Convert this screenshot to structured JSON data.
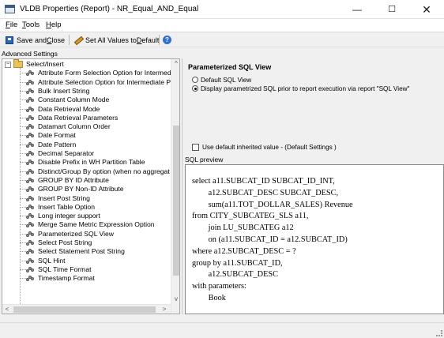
{
  "window": {
    "title": "VLDB Properties (Report) - NR_Equal_AND_Equal",
    "minimize_glyph": "—",
    "maximize_glyph": "☐",
    "close_glyph": "✕"
  },
  "menu": {
    "file": {
      "mnemonic": "F",
      "rest": "ile"
    },
    "tools": {
      "mnemonic": "T",
      "rest": "ools"
    },
    "help": {
      "mnemonic": "H",
      "rest": "elp"
    }
  },
  "toolbar": {
    "save_pre": "Save and ",
    "save_mnemonic": "C",
    "save_post": "lose",
    "setall_pre": "Set All Values to ",
    "setall_mnemonic": "D",
    "setall_post": "efault",
    "help_glyph": "?"
  },
  "advanced_settings_label": "Advanced Settings",
  "tree": {
    "root_label": "Select/Insert",
    "root_expander": "−",
    "items": [
      "Attribute Form Selection Option for Intermed",
      "Attribute Selection Option for Intermediate P",
      "Bulk Insert String",
      "Constant Column Mode",
      "Data Retrieval Mode",
      "Data Retrieval Parameters",
      "Datamart Column Order",
      "Date Format",
      "Date Pattern",
      "Decimal Separator",
      "Disable Prefix in WH Partition Table",
      "Distinct/Group By option (when no aggregat",
      "GROUP BY ID Attribute",
      "GROUP BY Non-ID Attribute",
      "Insert Post String",
      "Insert Table Option",
      "Long integer support",
      "Merge Same Metric Expression Option",
      "Parameterized SQL View",
      "Select Post String",
      "Select Statement Post String",
      "SQL Hint",
      "SQL Time Format",
      "Timestamp Format"
    ],
    "selected": "Parameterized SQL View"
  },
  "scroll_glyphs": {
    "up": "^",
    "down": "v",
    "left": "<",
    "right": ">"
  },
  "option_panel": {
    "title": "Parameterized SQL View",
    "radio_default": "Default SQL View",
    "radio_param": "Display parametrized SQL prior to report execution via report \"SQL View\"",
    "selected_option": "Display parametrized SQL prior to report execution via report \"SQL View\"",
    "use_default_checkbox": "Use default inherited value - (Default Settings )",
    "use_default_checked": false
  },
  "sql_preview": {
    "label": "SQL preview",
    "text": "select a11.SUBCAT_ID SUBCAT_ID_INT,\n        a12.SUBCAT_DESC SUBCAT_DESC,\n        sum(a11.TOT_DOLLAR_SALES) Revenue\nfrom CITY_SUBCATEG_SLS a11,\n        join LU_SUBCATEG a12\n        on (a11.SUBCAT_ID = a12.SUBCAT_ID)\nwhere a12.SUBCAT_DESC = ?\ngroup by a11.SUBCAT_ID,\n        a12.SUBCAT_DESC\nwith parameters:\n        Book"
  }
}
